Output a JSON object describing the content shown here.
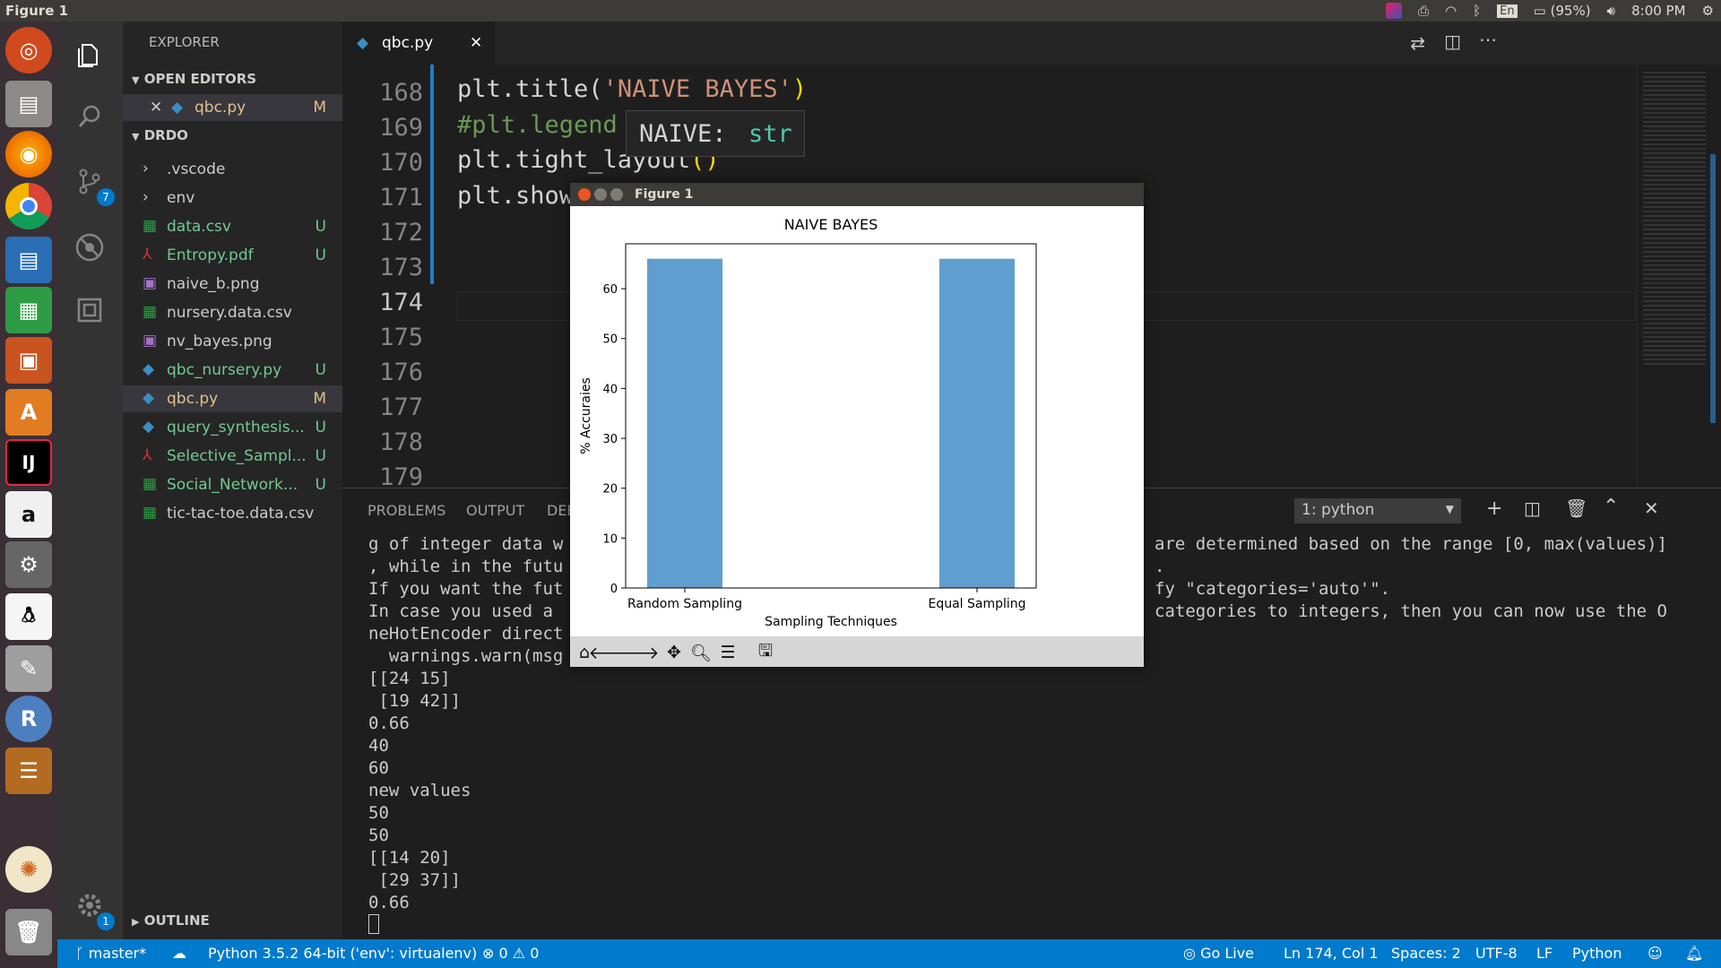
{
  "topbar": {
    "title": "Figure 1",
    "battery": "(95%)",
    "time": "8:00 PM",
    "lang": "En"
  },
  "launcher": {
    "items": [
      "ubuntu-icon",
      "files-icon",
      "firefox-icon",
      "chrome-icon",
      "writer-icon",
      "calc-icon",
      "impress-icon",
      "software-center-icon",
      "intellij-icon",
      "amazon-icon",
      "settings-tools-icon",
      "tux-icon",
      "disk-utility-icon",
      "r-icon",
      "app-stack-icon"
    ]
  },
  "activity": {
    "scm_badge": "7",
    "settings_badge": "1"
  },
  "sidebar": {
    "explorer_label": "EXPLORER",
    "open_editors_label": "OPEN EDITORS",
    "open_editor": {
      "name": "qbc.py",
      "status": "M"
    },
    "folder_label": "DRDO",
    "items": [
      {
        "name": ".vscode",
        "status": "",
        "type": "folder",
        "color": "#cccccc"
      },
      {
        "name": "env",
        "status": "",
        "type": "folder",
        "color": "#cccccc"
      },
      {
        "name": "data.csv",
        "status": "U",
        "type": "csv",
        "color": "#73c991"
      },
      {
        "name": "Entropy.pdf",
        "status": "U",
        "type": "pdf",
        "color": "#73c991"
      },
      {
        "name": "naive_b.png",
        "status": "",
        "type": "img",
        "color": "#cccccc"
      },
      {
        "name": "nursery.data.csv",
        "status": "",
        "type": "csv",
        "color": "#cccccc"
      },
      {
        "name": "nv_bayes.png",
        "status": "",
        "type": "img",
        "color": "#cccccc"
      },
      {
        "name": "qbc_nursery.py",
        "status": "U",
        "type": "py",
        "color": "#73c991"
      },
      {
        "name": "qbc.py",
        "status": "M",
        "type": "py",
        "color": "#e2c08d"
      },
      {
        "name": "query_synthesis...",
        "status": "U",
        "type": "py",
        "color": "#73c991"
      },
      {
        "name": "Selective_Sampl...",
        "status": "U",
        "type": "pdf",
        "color": "#73c991"
      },
      {
        "name": "Social_Network...",
        "status": "U",
        "type": "csv",
        "color": "#73c991"
      },
      {
        "name": "tic-tac-toe.data.csv",
        "status": "",
        "type": "csv",
        "color": "#cccccc"
      }
    ],
    "outline_label": "OUTLINE"
  },
  "editor": {
    "tab": "qbc.py",
    "line_numbers": [
      "168",
      "169",
      "170",
      "171",
      "172",
      "173",
      "174",
      "175",
      "176",
      "177",
      "178",
      "179"
    ],
    "lines": [
      {
        "a": "plt.title(",
        "b": "'NAIVE BAYES'",
        "c": ")"
      },
      {
        "a": "#plt.legend",
        "b": "",
        "c": ""
      },
      {
        "a": "plt.tight_layout",
        "b": "",
        "c": "()"
      },
      {
        "a": "plt.show",
        "b": "",
        "c": ""
      }
    ],
    "tooltip_name": "NAIVE:",
    "tooltip_type": "str"
  },
  "panel": {
    "tabs": [
      "PROBLEMS",
      "OUTPUT",
      "DEBUG CONSOLE"
    ],
    "terminal_select": "1: python",
    "left_lines": [
      "g of integer data w",
      ", while in the futu",
      "If you want the fut",
      "In case you used a ",
      "neHotEncoder direct",
      "  warnings.warn(msg",
      "[[24 15]",
      " [19 42]]",
      "0.66",
      "40",
      "60",
      "new values",
      "50",
      "50",
      "[[14 20]",
      " [29 37]]",
      "0.66"
    ],
    "right_lines": [
      "are determined based on the range [0, max(values)]",
      ".",
      "fy \"categories='auto'\".",
      "categories to integers, then you can now use the O"
    ]
  },
  "status": {
    "branch": "master*",
    "python": "Python 3.5.2 64-bit ('env': virtualenv)",
    "errors": "0",
    "warnings": "0",
    "golive": "Go Live",
    "position": "Ln 174, Col 1",
    "spaces": "Spaces: 2",
    "encoding": "UTF-8",
    "eol": "LF",
    "language": "Python"
  },
  "figure": {
    "window_title": "Figure 1",
    "chart_data": {
      "type": "bar",
      "title": "NAIVE BAYES",
      "xlabel": "Sampling Techniques",
      "ylabel": "% Accuraies",
      "categories": [
        "Random Sampling",
        "Equal Sampling"
      ],
      "values": [
        66,
        66
      ],
      "ylim": [
        0,
        69
      ],
      "yticks": [
        0,
        10,
        20,
        30,
        40,
        50,
        60
      ],
      "bar_color": "#5f9ecf"
    }
  }
}
